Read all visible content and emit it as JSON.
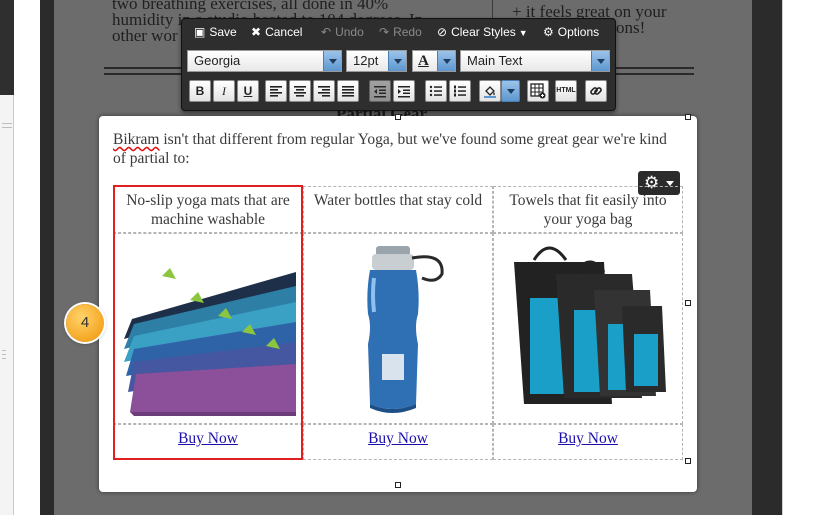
{
  "background_text": {
    "line1_left": "two breathing exercises, all done in 40%",
    "line2_left": "humidity in a studio heated to 104 degrees. In",
    "line3_left": "other wor",
    "line1_right": "+ it feels great on your",
    "line2_right": "ons!",
    "heading": "Partial Gear"
  },
  "toolbar": {
    "save": "Save",
    "cancel": "Cancel",
    "undo": "Undo",
    "redo": "Redo",
    "clear_styles": "Clear Styles",
    "options": "Options",
    "font_family": "Georgia",
    "font_size": "12pt",
    "text_style": "Main Text",
    "icons": [
      "bold-icon",
      "italic-icon",
      "underline-icon",
      "align-left-icon",
      "align-center-icon",
      "align-right-icon",
      "justify-icon",
      "outdent-icon",
      "indent-icon",
      "bullet-list-icon",
      "numbered-list-icon",
      "fill-color-icon",
      "table-icon",
      "html-icon",
      "link-icon"
    ],
    "html_label": "HTML",
    "bold_label": "B",
    "italic_label": "I",
    "underline_label": "U",
    "font_color_label": "A"
  },
  "content": {
    "intro_misspelled": "Bikram",
    "intro_rest": " isn't that different from regular Yoga, but we've found some great gear we're kind of partial to:",
    "columns": [
      {
        "heading": "No-slip yoga mats that are machine washable",
        "image": "yoga-mats-image",
        "link": "Buy Now"
      },
      {
        "heading": "Water bottles that stay cold",
        "image": "water-bottle-image",
        "link": "Buy Now"
      },
      {
        "heading": "Towels that fit easily into your yoga bag",
        "image": "towels-image",
        "link": "Buy Now"
      }
    ]
  },
  "step_badge": "4",
  "colors": {
    "toolbar_bg": "#2e2e2e",
    "selection_border": "#e02020",
    "badge": "#f5a623",
    "link": "#1a0dab"
  }
}
